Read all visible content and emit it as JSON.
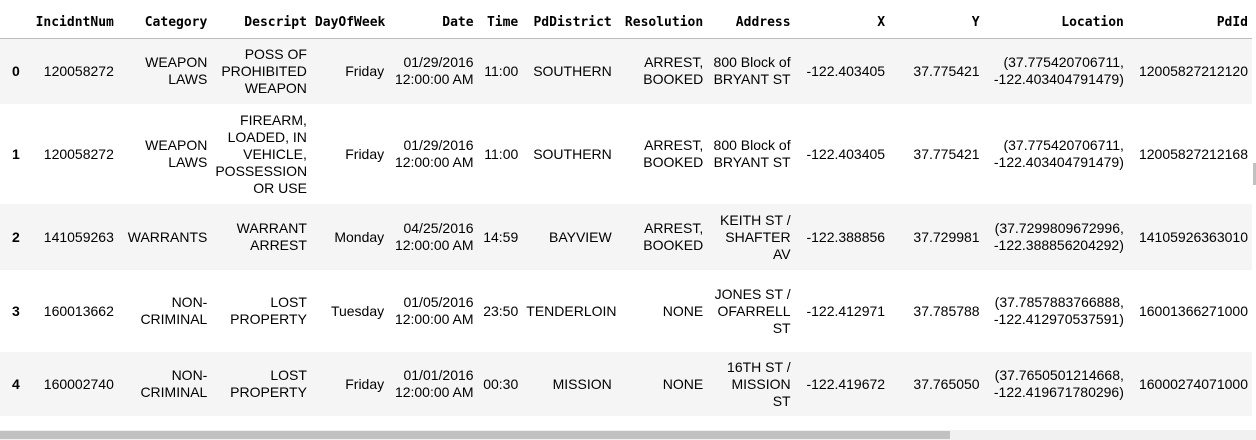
{
  "columns": [
    "",
    "IncidntNum",
    "Category",
    "Descript",
    "DayOfWeek",
    "Date",
    "Time",
    "PdDistrict",
    "Resolution",
    "Address",
    "X",
    "Y",
    "Location",
    "PdId"
  ],
  "rows": [
    [
      "0",
      "120058272",
      "WEAPON LAWS",
      "POSS OF PROHIBITED WEAPON",
      "Friday",
      "01/29/2016 12:00:00 AM",
      "11:00",
      "SOUTHERN",
      "ARREST, BOOKED",
      "800 Block of BRYANT ST",
      "-122.403405",
      "37.775421",
      "(37.775420706711, -122.403404791479)",
      "12005827212120"
    ],
    [
      "1",
      "120058272",
      "WEAPON LAWS",
      "FIREARM, LOADED, IN VEHICLE, POSSESSION OR USE",
      "Friday",
      "01/29/2016 12:00:00 AM",
      "11:00",
      "SOUTHERN",
      "ARREST, BOOKED",
      "800 Block of BRYANT ST",
      "-122.403405",
      "37.775421",
      "(37.775420706711, -122.403404791479)",
      "12005827212168"
    ],
    [
      "2",
      "141059263",
      "WARRANTS",
      "WARRANT ARREST",
      "Monday",
      "04/25/2016 12:00:00 AM",
      "14:59",
      "BAYVIEW",
      "ARREST, BOOKED",
      "KEITH ST / SHAFTER AV",
      "-122.388856",
      "37.729981",
      "(37.7299809672996, -122.388856204292)",
      "14105926363010"
    ],
    [
      "3",
      "160013662",
      "NON-CRIMINAL",
      "LOST PROPERTY",
      "Tuesday",
      "01/05/2016 12:00:00 AM",
      "23:50",
      "TENDERLOIN",
      "NONE",
      "JONES ST / OFARRELL ST",
      "-122.412971",
      "37.785788",
      "(37.7857883766888, -122.412970537591)",
      "16001366271000"
    ],
    [
      "4",
      "160002740",
      "NON-CRIMINAL",
      "LOST PROPERTY",
      "Friday",
      "01/01/2016 12:00:00 AM",
      "00:30",
      "MISSION",
      "NONE",
      "16TH ST / MISSION ST",
      "-122.419672",
      "37.765050",
      "(37.7650501214668, -122.419671780296)",
      "16000274071000"
    ]
  ]
}
